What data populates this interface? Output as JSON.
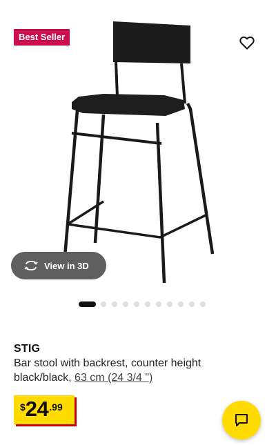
{
  "product": {
    "badge": "Best Seller",
    "name": "STIG",
    "description": "Bar stool with backrest, counter height",
    "color": "black/black,",
    "size_link": "63 cm (24 3/4 \")",
    "price": {
      "currency": "$",
      "integer": "24",
      "decimal": ".99"
    }
  },
  "view3d": {
    "label": "View in 3D"
  },
  "carousel": {
    "count": 11,
    "active_index": 0
  },
  "colors": {
    "badge_bg": "#cc0d4f",
    "price_bg": "#ffdb00",
    "price_shadow": "#cc0008",
    "chat_bg": "#ffdb00"
  },
  "icons": {
    "favorite": "heart-outline-icon",
    "view3d": "rotate-3d-icon",
    "chat": "chat-bubble-icon"
  }
}
